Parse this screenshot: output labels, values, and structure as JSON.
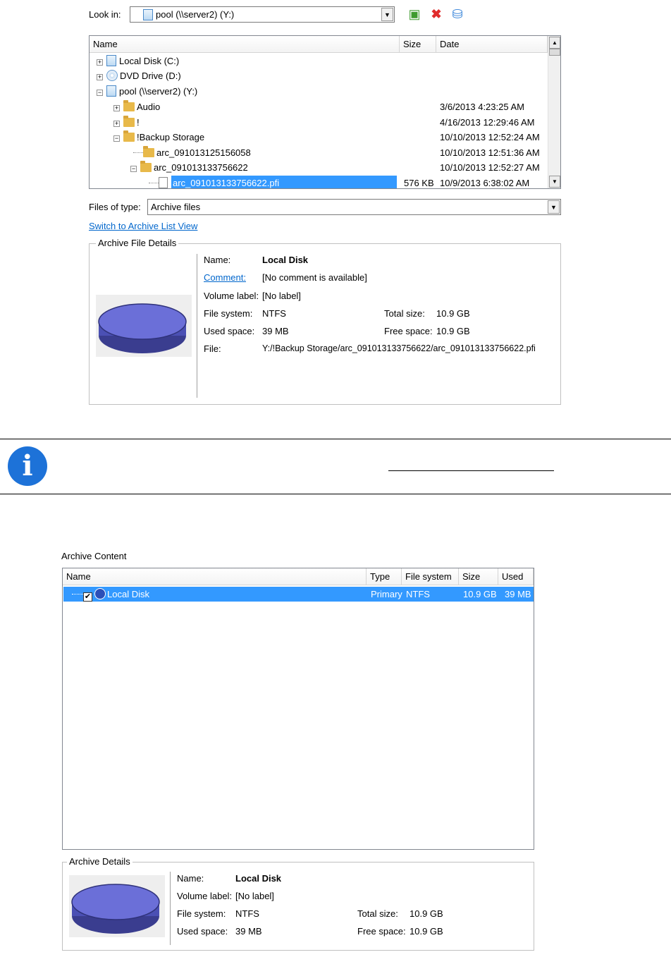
{
  "dialog": {
    "look_in_label": "Look in:",
    "look_in_value": "pool (\\\\server2) (Y:)",
    "toolbar_icons": [
      "new-folder-icon",
      "delete-icon",
      "network-icon"
    ],
    "columns": {
      "name": "Name",
      "size": "Size",
      "date": "Date"
    },
    "tree": [
      {
        "label": "Local Disk (C:)",
        "size": "",
        "date": "",
        "icon": "drive-icon",
        "expander": "+"
      },
      {
        "label": "DVD Drive (D:)",
        "size": "",
        "date": "",
        "icon": "dvd-icon",
        "expander": "+"
      },
      {
        "label": "pool (\\\\server2) (Y:)",
        "size": "",
        "date": "",
        "icon": "drive-icon",
        "expander": "−"
      },
      {
        "label": "Audio",
        "size": "",
        "date": "3/6/2013 4:23:25 AM",
        "icon": "folder-icon",
        "expander": "+"
      },
      {
        "label": "!",
        "size": "",
        "date": "4/16/2013 12:29:46 AM",
        "icon": "folder-icon",
        "expander": "+"
      },
      {
        "label": "!Backup Storage",
        "size": "",
        "date": "10/10/2013 12:52:24 AM",
        "icon": "folder-icon",
        "expander": "−"
      },
      {
        "label": "arc_091013125156058",
        "size": "",
        "date": "10/10/2013 12:51:36 AM",
        "icon": "folder-icon",
        "expander": ""
      },
      {
        "label": "arc_091013133756622",
        "size": "",
        "date": "10/10/2013 12:52:27 AM",
        "icon": "folder-icon",
        "expander": "−"
      },
      {
        "label": "arc_091013133756622.pfi",
        "size": "576 KB",
        "date": "10/9/2013 6:38:02 AM",
        "icon": "file-icon",
        "expander": "",
        "selected": true
      }
    ],
    "files_of_type_label": "Files of type:",
    "files_of_type_value": "Archive files",
    "switch_link": "Switch to Archive List View",
    "details": {
      "title": "Archive File Details",
      "name_label": "Name:",
      "name_value": "Local Disk",
      "comment_label": "Comment:",
      "comment_value": "[No comment is available]",
      "volume_label": "Volume label:",
      "volume_value": "[No label]",
      "fs_label": "File system:",
      "fs_value": "NTFS",
      "total_label": "Total size:",
      "total_value": "10.9 GB",
      "used_label": "Used space:",
      "used_value": "39 MB",
      "free_label": "Free space:",
      "free_value": "10.9 GB",
      "file_label": "File:",
      "file_value": "Y:/!Backup Storage/arc_091013133756622/arc_091013133756622.pfi"
    }
  },
  "archive": {
    "title": "Archive Content",
    "columns": {
      "name": "Name",
      "type": "Type",
      "fs": "File system",
      "size": "Size",
      "used": "Used"
    },
    "rows": [
      {
        "name": "Local Disk",
        "type": "Primary",
        "fs": "NTFS",
        "size": "10.9 GB",
        "used": "39 MB",
        "checked": true,
        "selected": true
      }
    ],
    "details": {
      "title": "Archive Details",
      "name_label": "Name:",
      "name_value": "Local Disk",
      "volume_label": "Volume label:",
      "volume_value": "[No label]",
      "fs_label": "File system:",
      "fs_value": "NTFS",
      "total_label": "Total size:",
      "total_value": "10.9 GB",
      "used_label": "Used space:",
      "used_value": "39 MB",
      "free_label": "Free space:",
      "free_value": "10.9 GB"
    }
  },
  "colors": {
    "selection": "#3399ff",
    "link": "#0066cc",
    "info": "#1d72d8",
    "disk": "#6b6fd8"
  }
}
